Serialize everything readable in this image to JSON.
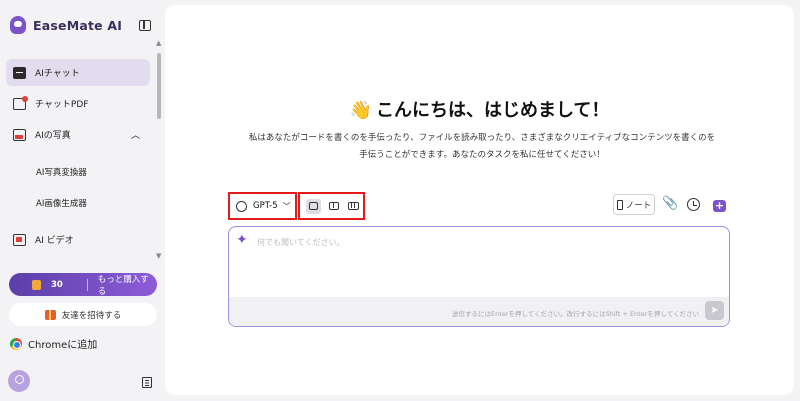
{
  "sidebar": {
    "brand": "EaseMate AI",
    "nav": [
      {
        "label": "AIチャット"
      },
      {
        "label": "チャットPDF"
      },
      {
        "label": "AIの写真"
      },
      {
        "label": "AI ビデオ"
      }
    ],
    "photo_sub": [
      "AI写真変換器",
      "AI画像生成器"
    ],
    "credits": {
      "count": "30",
      "buy_label": "もっと購入する"
    },
    "invite_label": "友達を招待する",
    "chrome_label": "Chromeに追加"
  },
  "main": {
    "greeting": "こんにちは、はじめまして！",
    "description": "私はあなたがコードを書くのを手伝ったり、ファイルを読み取ったり、さまざまなクリエイティブなコンテンツを書くのを手伝うことができます。あなたのタスクを私に任せてください！",
    "model": "GPT-5",
    "note_label": "ノート",
    "input_placeholder": "何でも聞いてください。",
    "hint": "送信するにはEnterを押してください。改行するにはShift + Enterを押してください"
  },
  "icons": {
    "wave": "👋",
    "sparkle": "✦",
    "clip": "📎",
    "send": "➤"
  },
  "colors": {
    "brand": "#7a54c9",
    "highlight_border": "#e21b1b",
    "active_nav": "#e3dcee"
  }
}
